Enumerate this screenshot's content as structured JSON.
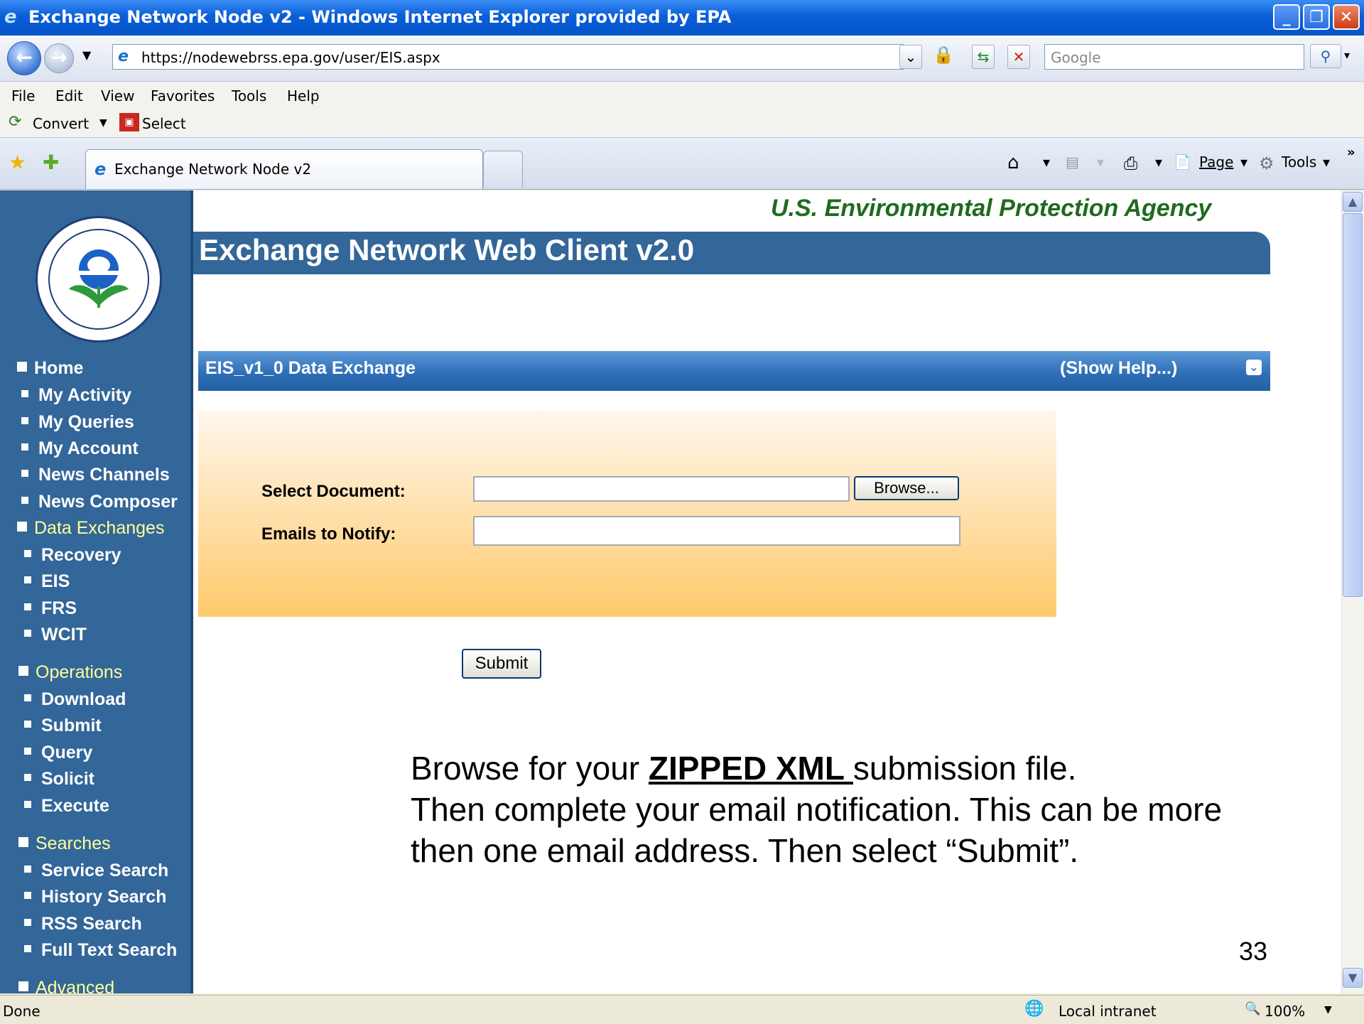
{
  "window": {
    "title": "Exchange Network Node v2 - Windows Internet Explorer provided by EPA"
  },
  "address": {
    "url": "https://nodewebrss.epa.gov/user/EIS.aspx",
    "search_placeholder": "Google"
  },
  "menu": [
    "File",
    "Edit",
    "View",
    "Favorites",
    "Tools",
    "Help"
  ],
  "command": {
    "convert": "Convert",
    "select": "Select"
  },
  "tabs": {
    "active": "Exchange Network Node v2"
  },
  "toolbar": {
    "page": "Page",
    "tools": "Tools"
  },
  "header": {
    "agency": "U.S. Environmental Protection Agency",
    "app_title": "Exchange Network Web Client v2.0"
  },
  "sidebar": {
    "home": "Home",
    "home_items": [
      "My Activity",
      "My Queries",
      "My Account",
      "News Channels",
      "News Composer"
    ],
    "data_exchanges": "Data Exchanges",
    "exchange_items": [
      "Recovery",
      "EIS",
      "FRS",
      "WCIT"
    ],
    "operations": "Operations",
    "operation_items": [
      "Download",
      "Submit",
      "Query",
      "Solicit",
      "Execute"
    ],
    "searches": "Searches",
    "search_items": [
      "Service Search",
      "History Search",
      "RSS Search",
      "Full Text Search"
    ],
    "advanced": "Advanced"
  },
  "exchange": {
    "title": "EIS_v1_0 Data Exchange",
    "show_help": "(Show Help...)"
  },
  "form": {
    "select_document": "Select Document:",
    "browse": "Browse...",
    "emails_to_notify": "Emails to Notify:",
    "submit": "Submit"
  },
  "instructions": {
    "line1_a": "Browse for your ",
    "line1_highlight": "ZIPPED XML ",
    "line1_b": "submission file.",
    "line2": "Then complete your email notification.  This can be more then one email address. Then select “Submit”."
  },
  "slide_number": "33",
  "status": {
    "text": "Done",
    "zone": "Local intranet",
    "zoom": "100%"
  }
}
